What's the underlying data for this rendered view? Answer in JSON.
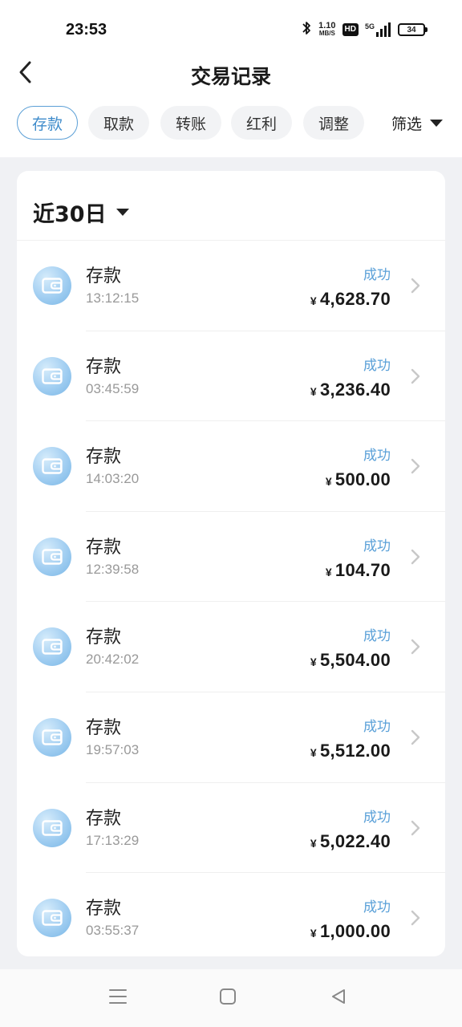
{
  "status_bar": {
    "time": "23:53",
    "net_speed_value": "1.10",
    "net_speed_unit": "MB/S",
    "hd_label": "HD",
    "network": "5G",
    "battery": "34"
  },
  "header": {
    "title": "交易记录",
    "back_icon": "chevron-left-icon"
  },
  "tabs": [
    {
      "label": "存款",
      "active": true
    },
    {
      "label": "取款",
      "active": false
    },
    {
      "label": "转账",
      "active": false
    },
    {
      "label": "红利",
      "active": false
    },
    {
      "label": "调整",
      "active": false
    }
  ],
  "filter": {
    "label": "筛选",
    "icon": "triangle-down-icon"
  },
  "range": {
    "label": "近30日",
    "icon": "triangle-down-icon"
  },
  "currency_symbol": "¥",
  "transactions": [
    {
      "title": "存款",
      "time": "13:12:15",
      "status": "成功",
      "amount": "4,628.70"
    },
    {
      "title": "存款",
      "time": "03:45:59",
      "status": "成功",
      "amount": "3,236.40"
    },
    {
      "title": "存款",
      "time": "14:03:20",
      "status": "成功",
      "amount": "500.00"
    },
    {
      "title": "存款",
      "time": "12:39:58",
      "status": "成功",
      "amount": "104.70"
    },
    {
      "title": "存款",
      "time": "20:42:02",
      "status": "成功",
      "amount": "5,504.00"
    },
    {
      "title": "存款",
      "time": "19:57:03",
      "status": "成功",
      "amount": "5,512.00"
    },
    {
      "title": "存款",
      "time": "17:13:29",
      "status": "成功",
      "amount": "5,022.40"
    },
    {
      "title": "存款",
      "time": "03:55:37",
      "status": "成功",
      "amount": "1,000.00"
    }
  ],
  "colors": {
    "accent": "#3f8ccb",
    "status_success": "#5aa0d8",
    "page_background": "#f0f1f4"
  },
  "system_nav": [
    "menu-icon",
    "home-square-icon",
    "back-triangle-icon"
  ]
}
